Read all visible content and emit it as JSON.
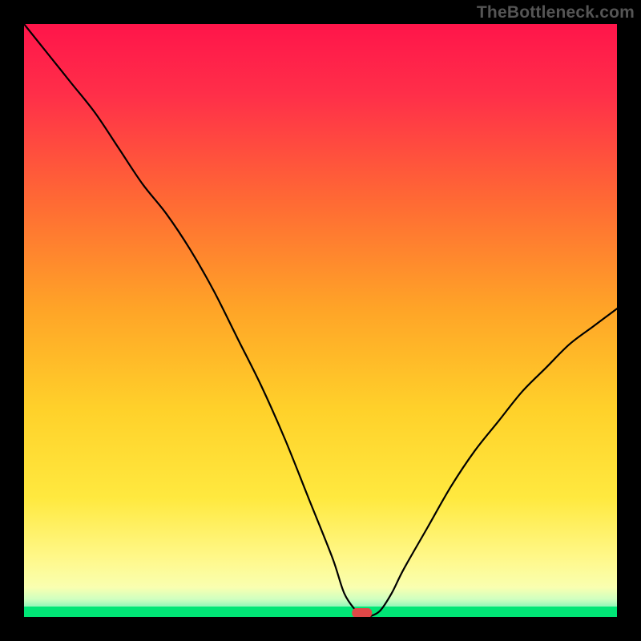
{
  "watermark": "TheBottleneck.com",
  "chart_data": {
    "type": "line",
    "title": "",
    "xlabel": "",
    "ylabel": "",
    "xlim": [
      0,
      100
    ],
    "ylim": [
      0,
      100
    ],
    "legend": false,
    "grid": false,
    "background_gradient": {
      "top": "#ff1a4b",
      "via1": "#ff8a2a",
      "via2": "#ffe03a",
      "via3": "#fffb99",
      "bottom": "#00e676"
    },
    "series": [
      {
        "name": "bottleneck-curve",
        "color": "#000000",
        "x": [
          0,
          4,
          8,
          12,
          16,
          20,
          24,
          28,
          32,
          36,
          40,
          44,
          48,
          52,
          54,
          56,
          57,
          58,
          60,
          62,
          64,
          68,
          72,
          76,
          80,
          84,
          88,
          92,
          96,
          100
        ],
        "y": [
          100,
          95,
          90,
          85,
          79,
          73,
          68,
          62,
          55,
          47,
          39,
          30,
          20,
          10,
          4,
          1,
          0,
          0,
          1,
          4,
          8,
          15,
          22,
          28,
          33,
          38,
          42,
          46,
          49,
          52
        ]
      }
    ],
    "marker": {
      "name": "optimal-point",
      "x": 57,
      "y": 0,
      "shape": "pill",
      "color": "#e04848"
    },
    "flat_segment": {
      "x_start": 54,
      "x_end": 58,
      "y": 0
    }
  }
}
